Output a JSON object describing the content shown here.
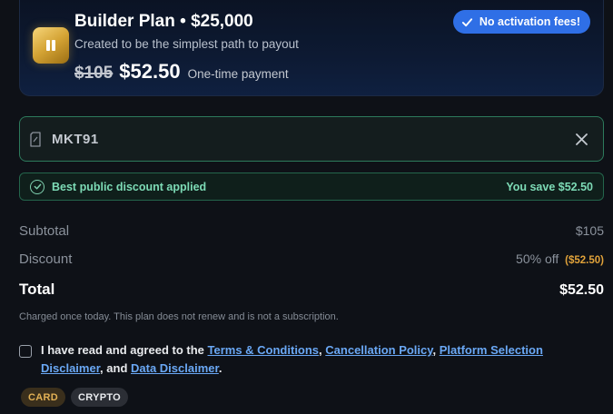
{
  "plan": {
    "title": "Builder Plan • $25,000",
    "subtitle": "Created to be the simplest path to payout",
    "old_price": "$105",
    "new_price": "$52.50",
    "price_note": "One-time payment",
    "badge": "No activation fees!",
    "icon": "pause-icon"
  },
  "coupon": {
    "code": "MKT91",
    "icon": "tag-icon",
    "clear_icon": "close-icon"
  },
  "applied": {
    "text": "Best public discount applied",
    "save": "You save $52.50"
  },
  "summary": {
    "subtotal_label": "Subtotal",
    "subtotal_value": "$105",
    "discount_label": "Discount",
    "discount_value": "50% off",
    "discount_amount": "($52.50)",
    "total_label": "Total",
    "total_value": "$52.50"
  },
  "charged_note": "Charged once today. This plan does not renew and is not a subscription.",
  "terms": {
    "prefix": "I have read and agreed to the ",
    "link1": "Terms & Conditions",
    "sep1": ", ",
    "link2": "Cancellation Policy",
    "sep2": ", ",
    "link3": "Platform Selection Disclaimer",
    "sep3": ", and ",
    "link4": "Data Disclaimer",
    "suffix": "."
  },
  "payment": {
    "card": "CARD",
    "crypto": "CRYPTO"
  },
  "colors": {
    "accent_blue": "#2f6fe6",
    "success_green": "#7ddbb6",
    "discount_orange": "#e0a23a",
    "link_blue": "#6aa8f5"
  }
}
